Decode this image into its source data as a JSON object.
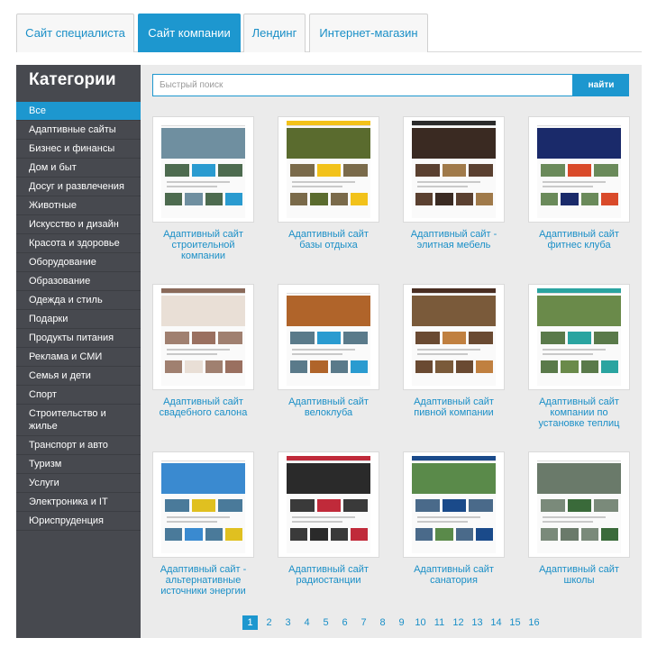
{
  "tabs": [
    {
      "label": "Сайт специалиста",
      "active": false
    },
    {
      "label": "Сайт компании",
      "active": true
    },
    {
      "label": "Лендинг",
      "active": false
    },
    {
      "label": "Интернет-магазин",
      "active": false
    }
  ],
  "sidebar": {
    "title": "Категории",
    "items": [
      {
        "label": "Все",
        "active": true
      },
      {
        "label": "Адаптивные сайты"
      },
      {
        "label": "Бизнес и финансы"
      },
      {
        "label": "Дом и быт"
      },
      {
        "label": "Досуг и развлечения"
      },
      {
        "label": "Животные"
      },
      {
        "label": "Искусство и дизайн"
      },
      {
        "label": "Красота и здоровье"
      },
      {
        "label": "Оборудование"
      },
      {
        "label": "Образование"
      },
      {
        "label": "Одежда и стиль"
      },
      {
        "label": "Подарки"
      },
      {
        "label": "Продукты питания"
      },
      {
        "label": "Реклама и СМИ"
      },
      {
        "label": "Семья и дети"
      },
      {
        "label": "Спорт"
      },
      {
        "label": "Строительство и жилье"
      },
      {
        "label": "Транспорт и авто"
      },
      {
        "label": "Туризм"
      },
      {
        "label": "Услуги"
      },
      {
        "label": "Электроника и IT"
      },
      {
        "label": "Юриспруденция"
      }
    ]
  },
  "search": {
    "placeholder": "Быстрый поиск",
    "button_label": "найти"
  },
  "templates": [
    {
      "title": "Адаптивный сайт строительной компании",
      "colors": {
        "bar": "#ffffff",
        "hero": "#6f8fa0",
        "accent": "#2a9bd0",
        "row": "#4d6b4f"
      }
    },
    {
      "title": "Адаптивный сайт базы отдыха",
      "colors": {
        "bar": "#f2c21a",
        "hero": "#5a6b2e",
        "accent": "#f2c21a",
        "row": "#7a6a4a"
      }
    },
    {
      "title": "Адаптивный сайт - элитная мебель",
      "colors": {
        "bar": "#2b2b2b",
        "hero": "#3a2a22",
        "accent": "#a07a4a",
        "row": "#5a4030"
      }
    },
    {
      "title": "Адаптивный сайт фитнес клуба",
      "colors": {
        "bar": "#ffffff",
        "hero": "#1a2a6a",
        "accent": "#d94a2a",
        "row": "#6a8a5a"
      }
    },
    {
      "title": "Адаптивный сайт свадебного салона",
      "colors": {
        "bar": "#8a6a5a",
        "hero": "#e9dfd6",
        "accent": "#9a7060",
        "row": "#a08070"
      }
    },
    {
      "title": "Адаптивный сайт велоклуба",
      "colors": {
        "bar": "#ffffff",
        "hero": "#b0642a",
        "accent": "#2a9bd0",
        "row": "#5a7a8a"
      }
    },
    {
      "title": "Адаптивный сайт пивной компании",
      "colors": {
        "bar": "#4a2e22",
        "hero": "#7a5a3a",
        "accent": "#c08040",
        "row": "#6a4a32"
      }
    },
    {
      "title": "Адаптивный сайт компании по установке теплиц",
      "colors": {
        "bar": "#2aa4a0",
        "hero": "#6a8a4a",
        "accent": "#2aa4a0",
        "row": "#5a7a4a"
      }
    },
    {
      "title": "Адаптивный сайт - альтернативные источники энергии",
      "colors": {
        "bar": "#ffffff",
        "hero": "#3a8ad0",
        "accent": "#e0c020",
        "row": "#4a7a9a"
      }
    },
    {
      "title": "Адаптивный сайт радиостанции",
      "colors": {
        "bar": "#c02a3a",
        "hero": "#2a2a2a",
        "accent": "#c02a3a",
        "row": "#3a3a3a"
      }
    },
    {
      "title": "Адаптивный сайт санатория",
      "colors": {
        "bar": "#1a4a8a",
        "hero": "#5a8a4a",
        "accent": "#1a4a8a",
        "row": "#4a6a8a"
      }
    },
    {
      "title": "Адаптивный сайт школы",
      "colors": {
        "bar": "#ffffff",
        "hero": "#6a7a6a",
        "accent": "#3a6a3a",
        "row": "#7a8a7a"
      }
    }
  ],
  "pagination": {
    "pages": [
      "1",
      "2",
      "3",
      "4",
      "5",
      "6",
      "7",
      "8",
      "9",
      "10",
      "11",
      "12",
      "13",
      "14",
      "15",
      "16"
    ],
    "current": "1"
  }
}
